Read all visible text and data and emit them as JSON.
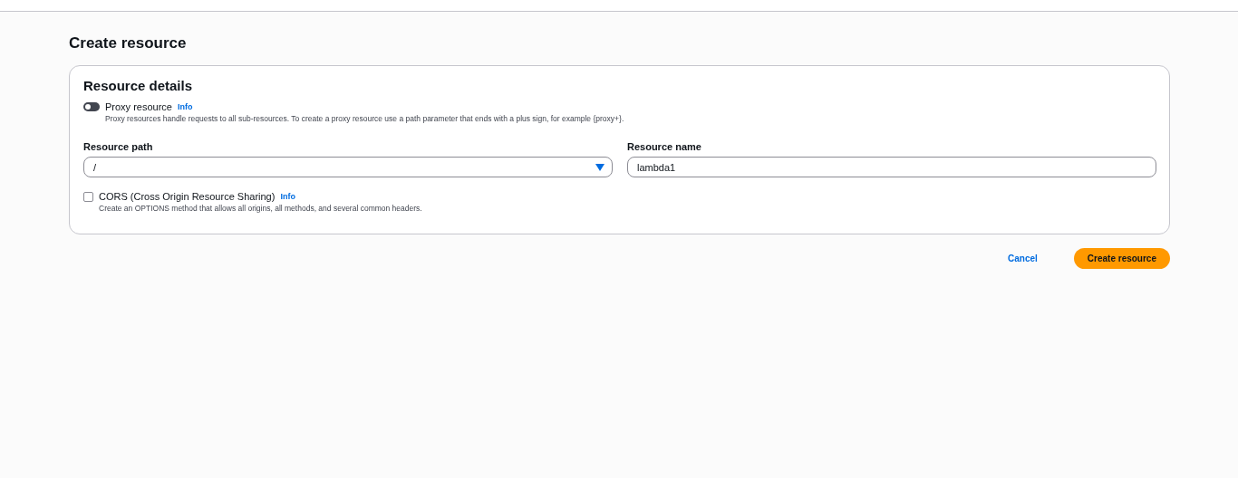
{
  "page_title": "Create resource",
  "panel": {
    "title": "Resource details",
    "proxy": {
      "label": "Proxy resource",
      "info": "Info",
      "on": false,
      "description": "Proxy resources handle requests to all sub-resources. To create a proxy resource use a path parameter that ends with a plus sign, for example {proxy+}."
    },
    "resource_path": {
      "label": "Resource path",
      "value": "/"
    },
    "resource_name": {
      "label": "Resource name",
      "value": "lambda1"
    },
    "cors": {
      "label": "CORS (Cross Origin Resource Sharing)",
      "info": "Info",
      "checked": false,
      "description": "Create an OPTIONS method that allows all origins, all methods, and several common headers."
    }
  },
  "actions": {
    "cancel": "Cancel",
    "submit": "Create resource"
  }
}
